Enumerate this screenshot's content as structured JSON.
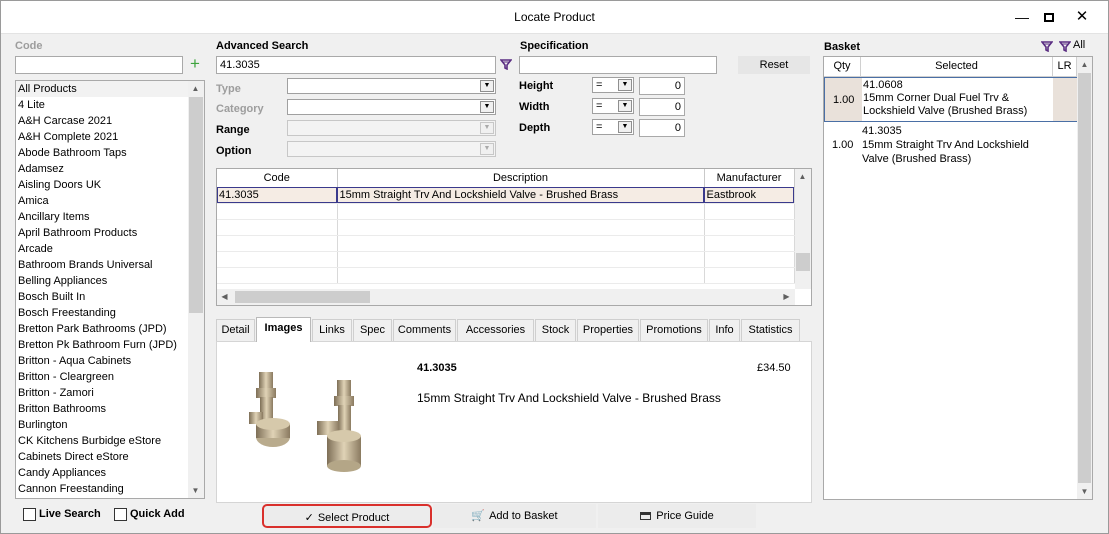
{
  "window": {
    "title": "Locate Product"
  },
  "code": {
    "label": "Code",
    "value": ""
  },
  "product_list": {
    "items": [
      "All Products",
      "4 Lite",
      "A&H Carcase 2021",
      "A&H Complete 2021",
      "Abode Bathroom Taps",
      "Adamsez",
      "Aisling Doors UK",
      "Amica",
      "Ancillary Items",
      "April Bathroom Products",
      "Arcade",
      "Bathroom Brands Universal",
      "Belling Appliances",
      "Bosch Built In",
      "Bosch Freestanding",
      "Bretton Park Bathrooms (JPD)",
      "Bretton Pk Bathroom Furn (JPD)",
      "Britton - Aqua Cabinets",
      "Britton - Cleargreen",
      "Britton - Zamori",
      "Britton Bathrooms",
      "Burlington",
      "CK Kitchens Burbidge eStore",
      "Cabinets Direct eStore",
      "Candy Appliances",
      "Cannon Freestanding"
    ]
  },
  "advanced_search": {
    "label": "Advanced Search",
    "value": "41.3035",
    "type_label": "Type",
    "category_label": "Category",
    "range_label": "Range",
    "option_label": "Option"
  },
  "specification": {
    "label": "Specification",
    "value": "",
    "reset_label": "Reset",
    "rows": [
      {
        "label": "Height",
        "op": "=",
        "value": "0"
      },
      {
        "label": "Width",
        "op": "=",
        "value": "0"
      },
      {
        "label": "Depth",
        "op": "=",
        "value": "0"
      }
    ]
  },
  "results": {
    "columns": [
      "Code",
      "Description",
      "Manufacturer"
    ],
    "rows": [
      {
        "code": "41.3035",
        "description": "15mm Straight Trv And Lockshield Valve - Brushed Brass",
        "manufacturer": "Eastbrook"
      }
    ]
  },
  "tabs": [
    "Detail",
    "Images",
    "Links",
    "Spec",
    "Comments",
    "Accessories",
    "Stock",
    "Properties",
    "Promotions",
    "Info",
    "Statistics"
  ],
  "detail": {
    "code": "41.3035",
    "price": "£34.50",
    "description": "15mm Straight Trv And Lockshield Valve - Brushed Brass"
  },
  "basket": {
    "label": "Basket",
    "all_label": "All",
    "columns": [
      "Qty",
      "Selected",
      "LR"
    ],
    "items": [
      {
        "qty": "1.00",
        "code": "41.0608",
        "line1": "15mm Corner Dual Fuel Trv &",
        "line2": "Lockshield Valve (Brushed Brass)"
      },
      {
        "qty": "1.00",
        "code": "41.3035",
        "line1": "15mm Straight Trv And Lockshield",
        "line2": "Valve (Brushed Brass)"
      }
    ]
  },
  "options": {
    "live_search_label": "Live Search",
    "quick_add_label": "Quick Add"
  },
  "actions": {
    "select_product_label": "Select Product",
    "add_to_basket_label": "Add to Basket",
    "price_guide_label": "Price Guide"
  },
  "colors": {
    "accent_red": "#d9302c",
    "filter_purple": "#5a2d82",
    "add_green": "#3ea33e"
  }
}
